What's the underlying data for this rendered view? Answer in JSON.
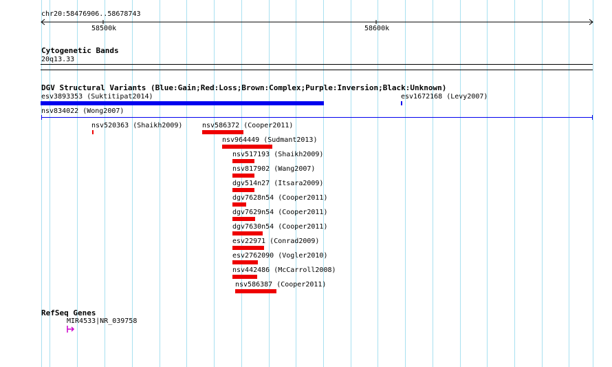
{
  "ruler": {
    "range_label": "chr20:58476906..58678743",
    "ticks": [
      "58500k",
      "58600k"
    ]
  },
  "cytoband": {
    "title": "Cytogenetic Bands",
    "band_label": "20q13.33"
  },
  "dgv": {
    "title": "DGV Structural Variants (Blue:Gain;Red:Loss;Brown:Complex;Purple:Inversion;Black:Unknown)",
    "variants": [
      {
        "label": "esv3893353 (Suktitipat2014)",
        "type": "gain",
        "color": "#0000ee"
      },
      {
        "label": "esv1672168 (Levy2007)",
        "type": "gain",
        "color": "#0000ee"
      },
      {
        "label": "nsv834022 (Wong2007)",
        "type": "gain",
        "color": "#0000ee"
      },
      {
        "label": "nsv520363 (Shaikh2009)",
        "type": "loss",
        "color": "#ee0000"
      },
      {
        "label": "nsv586372 (Cooper2011)",
        "type": "loss",
        "color": "#ee0000"
      },
      {
        "label": "nsv964449 (Sudmant2013)",
        "type": "loss",
        "color": "#ee0000"
      },
      {
        "label": "nsv517193 (Shaikh2009)",
        "type": "loss",
        "color": "#ee0000"
      },
      {
        "label": "nsv817902 (Wang2007)",
        "type": "loss",
        "color": "#ee0000"
      },
      {
        "label": "dgv514n27 (Itsara2009)",
        "type": "loss",
        "color": "#ee0000"
      },
      {
        "label": "dgv7628n54 (Cooper2011)",
        "type": "loss",
        "color": "#ee0000"
      },
      {
        "label": "dgv7629n54 (Cooper2011)",
        "type": "loss",
        "color": "#ee0000"
      },
      {
        "label": "dgv7630n54 (Cooper2011)",
        "type": "loss",
        "color": "#ee0000"
      },
      {
        "label": "esv22971 (Conrad2009)",
        "type": "loss",
        "color": "#ee0000"
      },
      {
        "label": "esv2762090 (Vogler2010)",
        "type": "loss",
        "color": "#ee0000"
      },
      {
        "label": "nsv442486 (McCarroll2008)",
        "type": "loss",
        "color": "#ee0000"
      },
      {
        "label": "nsv586387 (Cooper2011)",
        "type": "loss",
        "color": "#ee0000"
      }
    ]
  },
  "refseq": {
    "title": "RefSeq Genes",
    "gene_label": "MIR4533|NR_039758",
    "gene_color": "#cc00cc"
  },
  "colors": {
    "grid": "#a8e0f0",
    "gain": "#0000ee",
    "loss": "#ee0000"
  }
}
